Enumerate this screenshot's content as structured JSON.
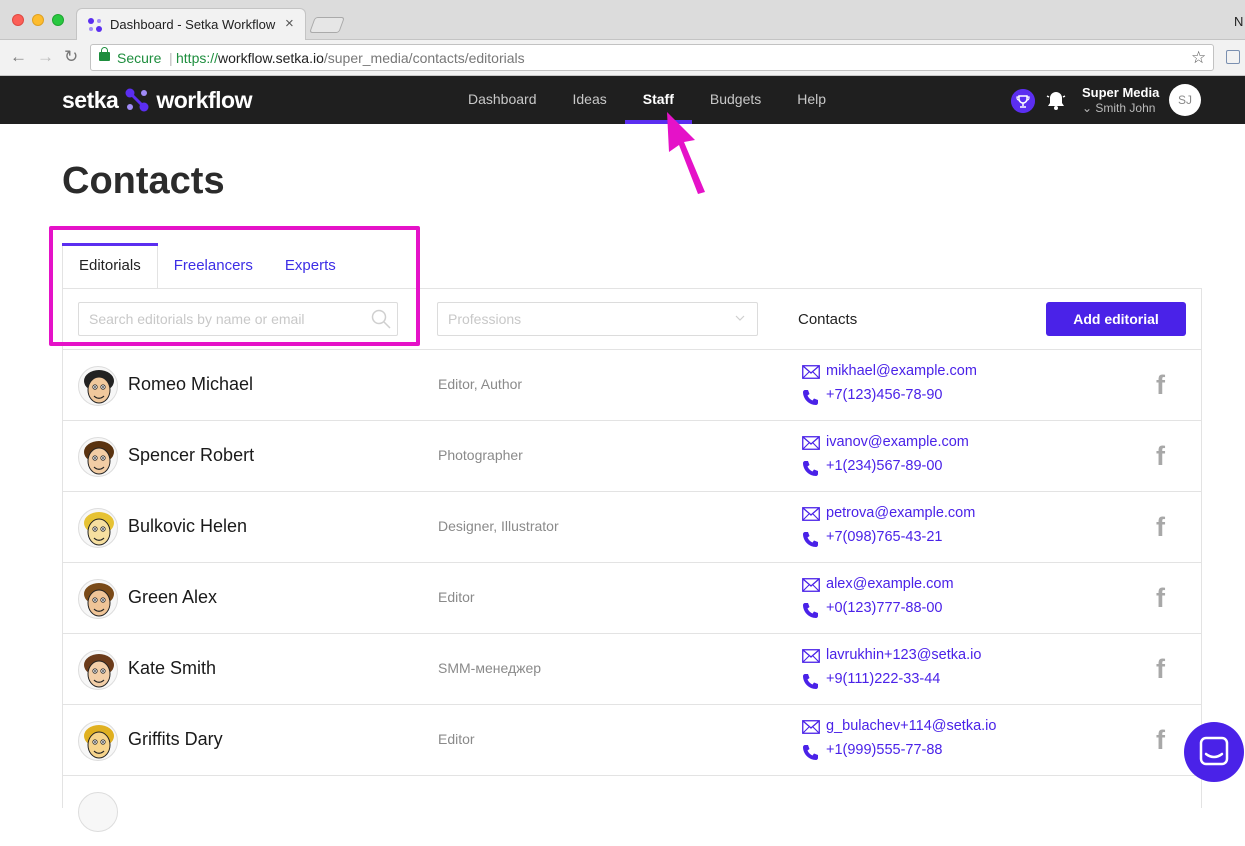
{
  "browser": {
    "tab_title": "Dashboard - Setka Workflow",
    "tab_close": "×",
    "edge_text": "N",
    "secure_label": "Secure",
    "url_scheme": "https://",
    "url_host": "workflow.setka.io",
    "url_path": "/super_media/contacts/editorials"
  },
  "app": {
    "logo_left": "setka",
    "logo_right": "workflow",
    "nav": [
      "Dashboard",
      "Ideas",
      "Staff",
      "Budgets",
      "Help"
    ],
    "active_nav": "Staff",
    "user_company": "Super Media",
    "user_name": "Smith John",
    "user_initials": "SJ"
  },
  "page": {
    "title": "Contacts",
    "tabs": [
      "Editorials",
      "Freelancers",
      "Experts"
    ],
    "active_tab": "Editorials",
    "search_placeholder": "Search editorials by name or email",
    "professions_placeholder": "Professions",
    "contacts_header": "Contacts",
    "add_button": "Add editorial"
  },
  "colors": {
    "accent": "#4a22e8",
    "annotation": "#e512c8",
    "header_bg": "#1f1f1f"
  },
  "contacts": [
    {
      "name": "Romeo Michael",
      "role": "Editor, Author",
      "email": "mikhael@example.com",
      "phone": "+7(123)456-78-90",
      "social": "f"
    },
    {
      "name": "Spencer Robert",
      "role": "Photographer",
      "email": "ivanov@example.com",
      "phone": "+1(234)567-89-00",
      "social": "f"
    },
    {
      "name": "Bulkovic Helen",
      "role": "Designer, Illustrator",
      "email": "petrova@example.com",
      "phone": "+7(098)765-43-21",
      "social": "f"
    },
    {
      "name": "Green Alex",
      "role": "Editor",
      "email": "alex@example.com",
      "phone": "+0(123)777-88-00",
      "social": "f"
    },
    {
      "name": "Kate Smith",
      "role": "SMM-менеджер",
      "email": "lavrukhin+123@setka.io",
      "phone": "+9(111)222-33-44",
      "social": "f"
    },
    {
      "name": "Griffits Dary",
      "role": "Editor",
      "email": "g_bulachev+114@setka.io",
      "phone": "+1(999)555-77-88",
      "social": "f"
    }
  ]
}
